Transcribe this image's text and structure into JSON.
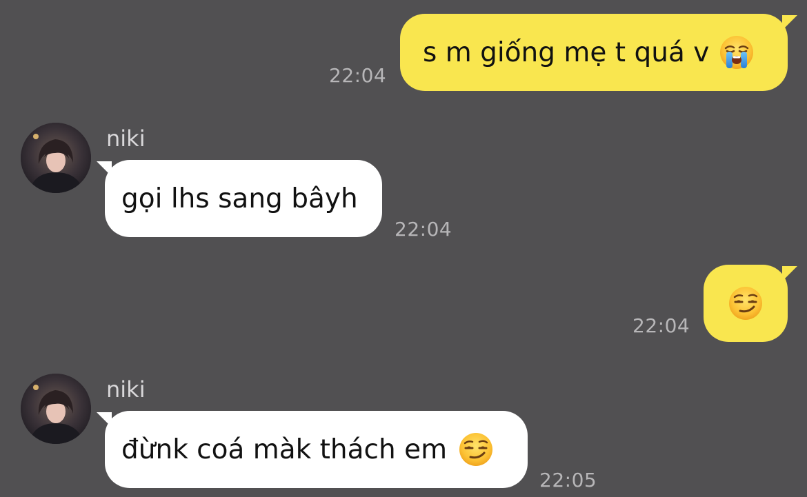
{
  "messages": [
    {
      "sender": "me",
      "text": "s m giống mẹ t quá v",
      "emoji": "loudly-crying-face-icon",
      "time": "22:04"
    },
    {
      "sender": "niki",
      "text": "gọi lhs sang bâyh",
      "time": "22:04"
    },
    {
      "sender": "me",
      "text": "",
      "emoji": "smirking-face-icon",
      "time": "22:04"
    },
    {
      "sender": "niki",
      "text": "đừnk coá màk thách em",
      "emoji": "smirking-face-icon",
      "time": "22:05"
    }
  ],
  "contact": {
    "name": "niki"
  },
  "colors": {
    "background": "#515052",
    "my_bubble": "#f9e64f",
    "their_bubble": "#ffffff",
    "timestamp": "#b7b6b8"
  }
}
